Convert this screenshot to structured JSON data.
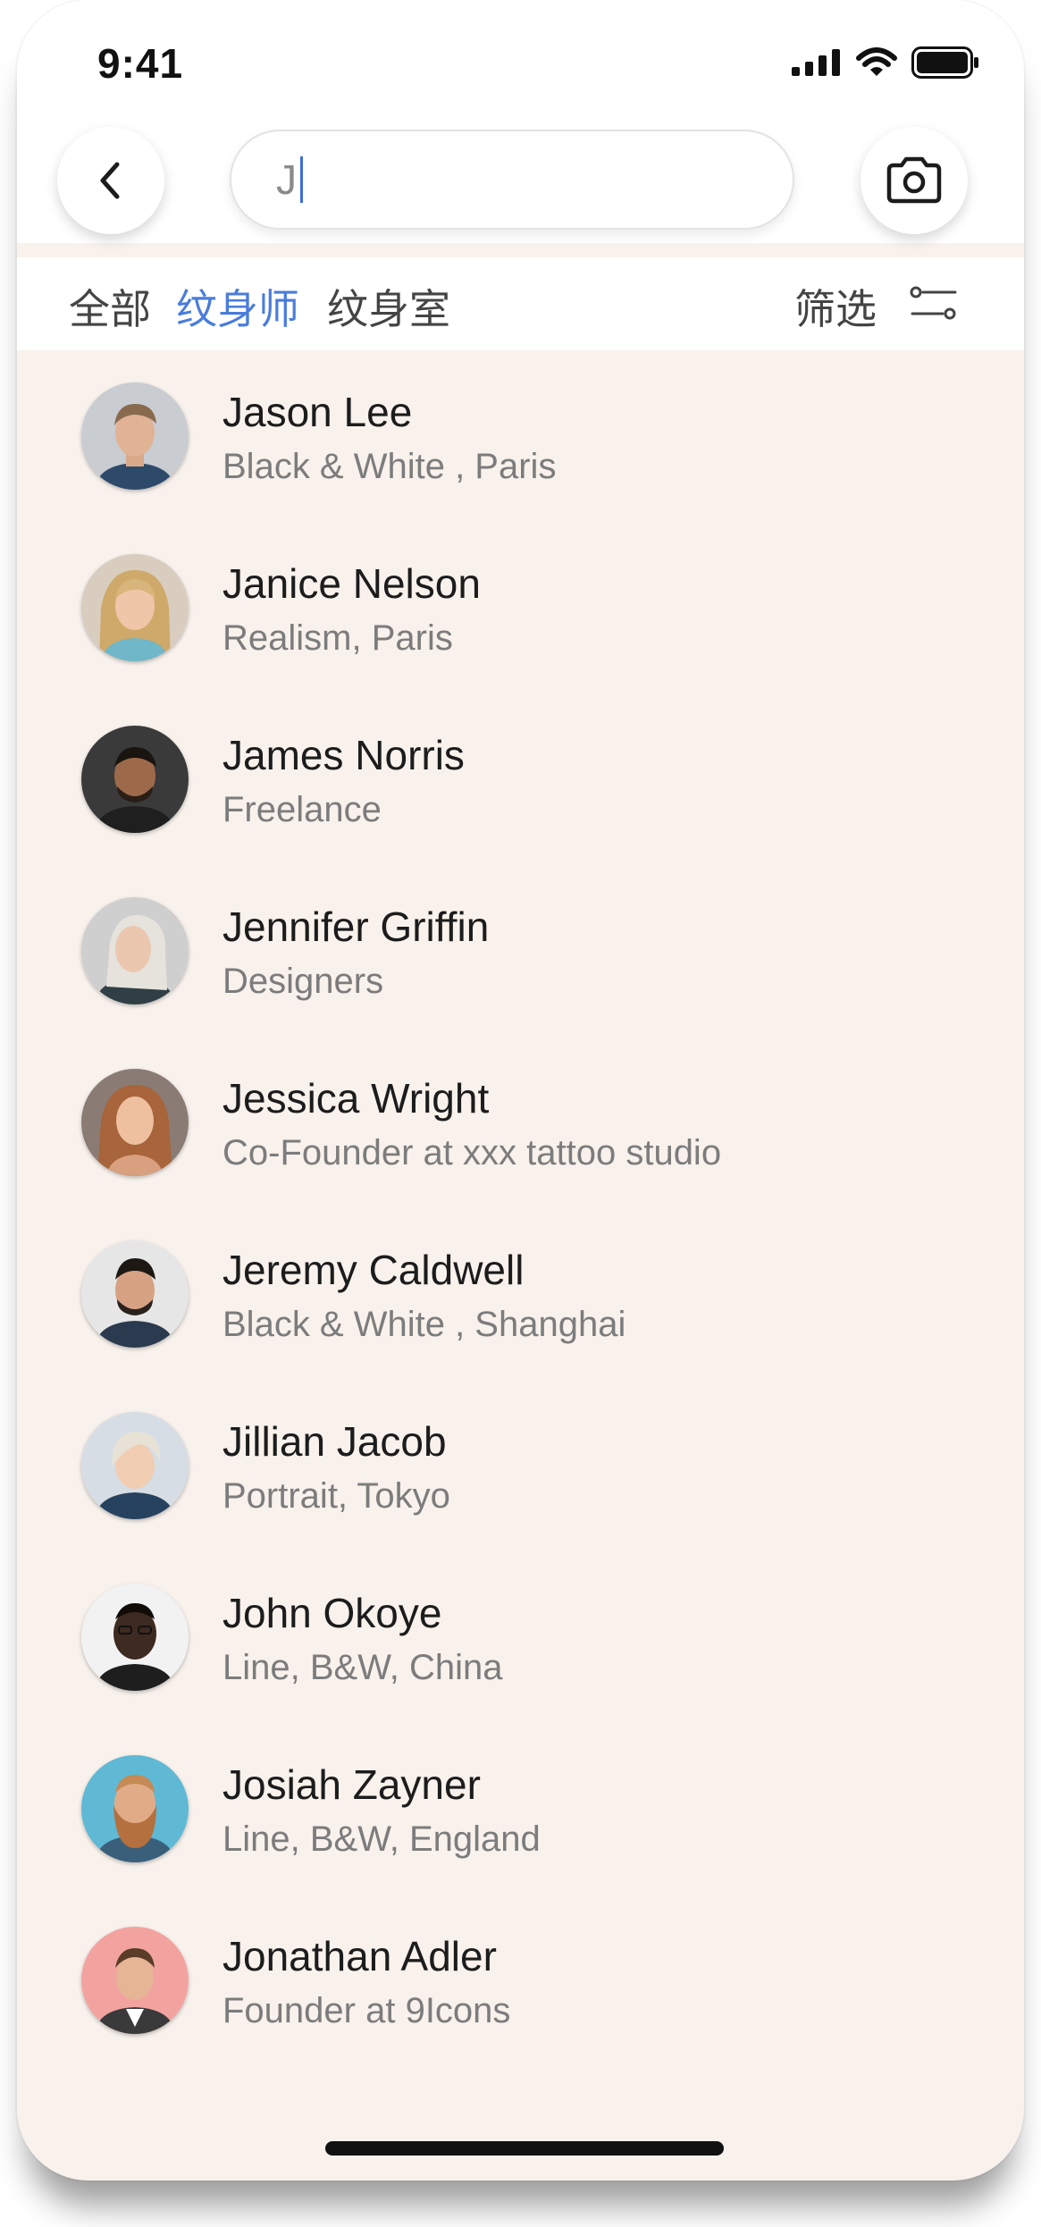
{
  "status_bar": {
    "time": "9:41"
  },
  "header": {
    "back_icon": "chevron-left-icon",
    "search_value": "J",
    "camera_icon": "camera-icon"
  },
  "tabs": {
    "all": "全部",
    "artist": "纹身师",
    "studio": "纹身室",
    "active": "artist",
    "filter_label": "筛选",
    "filter_icon": "sliders-icon"
  },
  "colors": {
    "accent": "#4a7ddb",
    "background": "#f8f1ec",
    "caret": "#3b6fd8"
  },
  "results": [
    {
      "name": "Jason Lee",
      "subtitle": "Black & White , Paris"
    },
    {
      "name": "Janice Nelson",
      "subtitle": "Realism, Paris"
    },
    {
      "name": "James Norris",
      "subtitle": "Freelance"
    },
    {
      "name": "Jennifer Griffin",
      "subtitle": "Designers"
    },
    {
      "name": "Jessica Wright",
      "subtitle": "Co-Founder at xxx tattoo studio"
    },
    {
      "name": "Jeremy Caldwell",
      "subtitle": "Black & White , Shanghai"
    },
    {
      "name": "Jillian Jacob",
      "subtitle": "Portrait, Tokyo"
    },
    {
      "name": "John Okoye",
      "subtitle": "Line, B&W, China"
    },
    {
      "name": "Josiah Zayner",
      "subtitle": "Line, B&W, England"
    },
    {
      "name": "Jonathan Adler",
      "subtitle": "Founder at 9Icons"
    }
  ]
}
